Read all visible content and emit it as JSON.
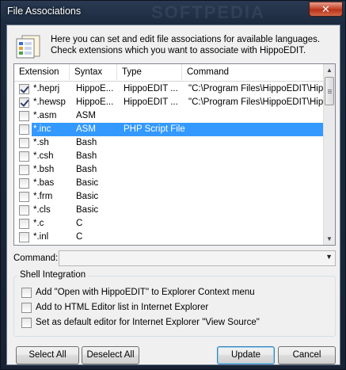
{
  "window": {
    "title": "File Associations",
    "watermark": "SOFTPEDIA"
  },
  "header": {
    "line1": "Here you can set and edit file associations for available languages.",
    "line2": "Check extensions which you want to associate with HippoEDIT."
  },
  "table": {
    "columns": [
      "Extension",
      "Syntax",
      "Type",
      "Command"
    ],
    "rows": [
      {
        "checked": true,
        "ext": "*.heprj",
        "syntax": "HippoE...",
        "type": "HippoEDIT ...",
        "command": "\"C:\\Program Files\\HippoEDIT\\Hipp...",
        "selected": false
      },
      {
        "checked": true,
        "ext": "*.hewsp",
        "syntax": "HippoE...",
        "type": "HippoEDIT ...",
        "command": "\"C:\\Program Files\\HippoEDIT\\Hipp...",
        "selected": false
      },
      {
        "checked": false,
        "ext": "*.asm",
        "syntax": "ASM",
        "type": "",
        "command": "",
        "selected": false
      },
      {
        "checked": false,
        "ext": "*.inc",
        "syntax": "ASM",
        "type": "PHP Script File",
        "command": "",
        "selected": true
      },
      {
        "checked": false,
        "ext": "*.sh",
        "syntax": "Bash",
        "type": "",
        "command": "",
        "selected": false
      },
      {
        "checked": false,
        "ext": "*.csh",
        "syntax": "Bash",
        "type": "",
        "command": "",
        "selected": false
      },
      {
        "checked": false,
        "ext": "*.bsh",
        "syntax": "Bash",
        "type": "",
        "command": "",
        "selected": false
      },
      {
        "checked": false,
        "ext": "*.bas",
        "syntax": "Basic",
        "type": "",
        "command": "",
        "selected": false
      },
      {
        "checked": false,
        "ext": "*.frm",
        "syntax": "Basic",
        "type": "",
        "command": "",
        "selected": false
      },
      {
        "checked": false,
        "ext": "*.cls",
        "syntax": "Basic",
        "type": "",
        "command": "",
        "selected": false
      },
      {
        "checked": false,
        "ext": "*.c",
        "syntax": "C",
        "type": "",
        "command": "",
        "selected": false
      },
      {
        "checked": false,
        "ext": "*.inl",
        "syntax": "C",
        "type": "",
        "command": "",
        "selected": false
      }
    ]
  },
  "command": {
    "label": "Command:",
    "value": ""
  },
  "shell": {
    "title": "Shell Integration",
    "options": [
      {
        "label": "Add \"Open with HippoEDIT\" to Explorer Context menu",
        "checked": false
      },
      {
        "label": "Add to HTML Editor list in Internet Explorer",
        "checked": false
      },
      {
        "label": "Set as default editor for Internet Explorer \"View Source\"",
        "checked": false
      }
    ]
  },
  "buttons": {
    "select_all": "Select All",
    "deselect_all": "Deselect All",
    "update": "Update",
    "cancel": "Cancel"
  },
  "icons": {
    "close": "close-icon",
    "header": "file-associations-icon"
  },
  "colors": {
    "selection": "#3399ff",
    "title_bar": "#1d2b40"
  }
}
